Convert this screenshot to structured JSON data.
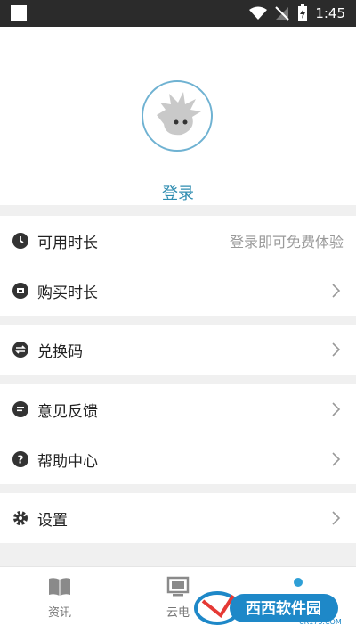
{
  "status_bar": {
    "time": "1:45"
  },
  "profile": {
    "login_label": "登录"
  },
  "menu": {
    "usage_time": {
      "label": "可用时长",
      "hint": "登录即可免费体验"
    },
    "buy_time": {
      "label": "购买时长"
    },
    "redeem_code": {
      "label": "兑换码"
    },
    "feedback": {
      "label": "意见反馈"
    },
    "help_center": {
      "label": "帮助中心"
    },
    "settings": {
      "label": "设置"
    }
  },
  "tabs": [
    {
      "label": "资讯",
      "icon": "book-icon"
    },
    {
      "label": "云电",
      "icon": "monitor-icon"
    },
    {
      "label": "",
      "icon": "profile-icon"
    }
  ],
  "watermark": {
    "text": "西西软件园",
    "url_text": "CR173.COM"
  },
  "colors": {
    "accent": "#2e8cb0",
    "avatar_border": "#6fb2d2",
    "background": "#f0f0f0"
  }
}
